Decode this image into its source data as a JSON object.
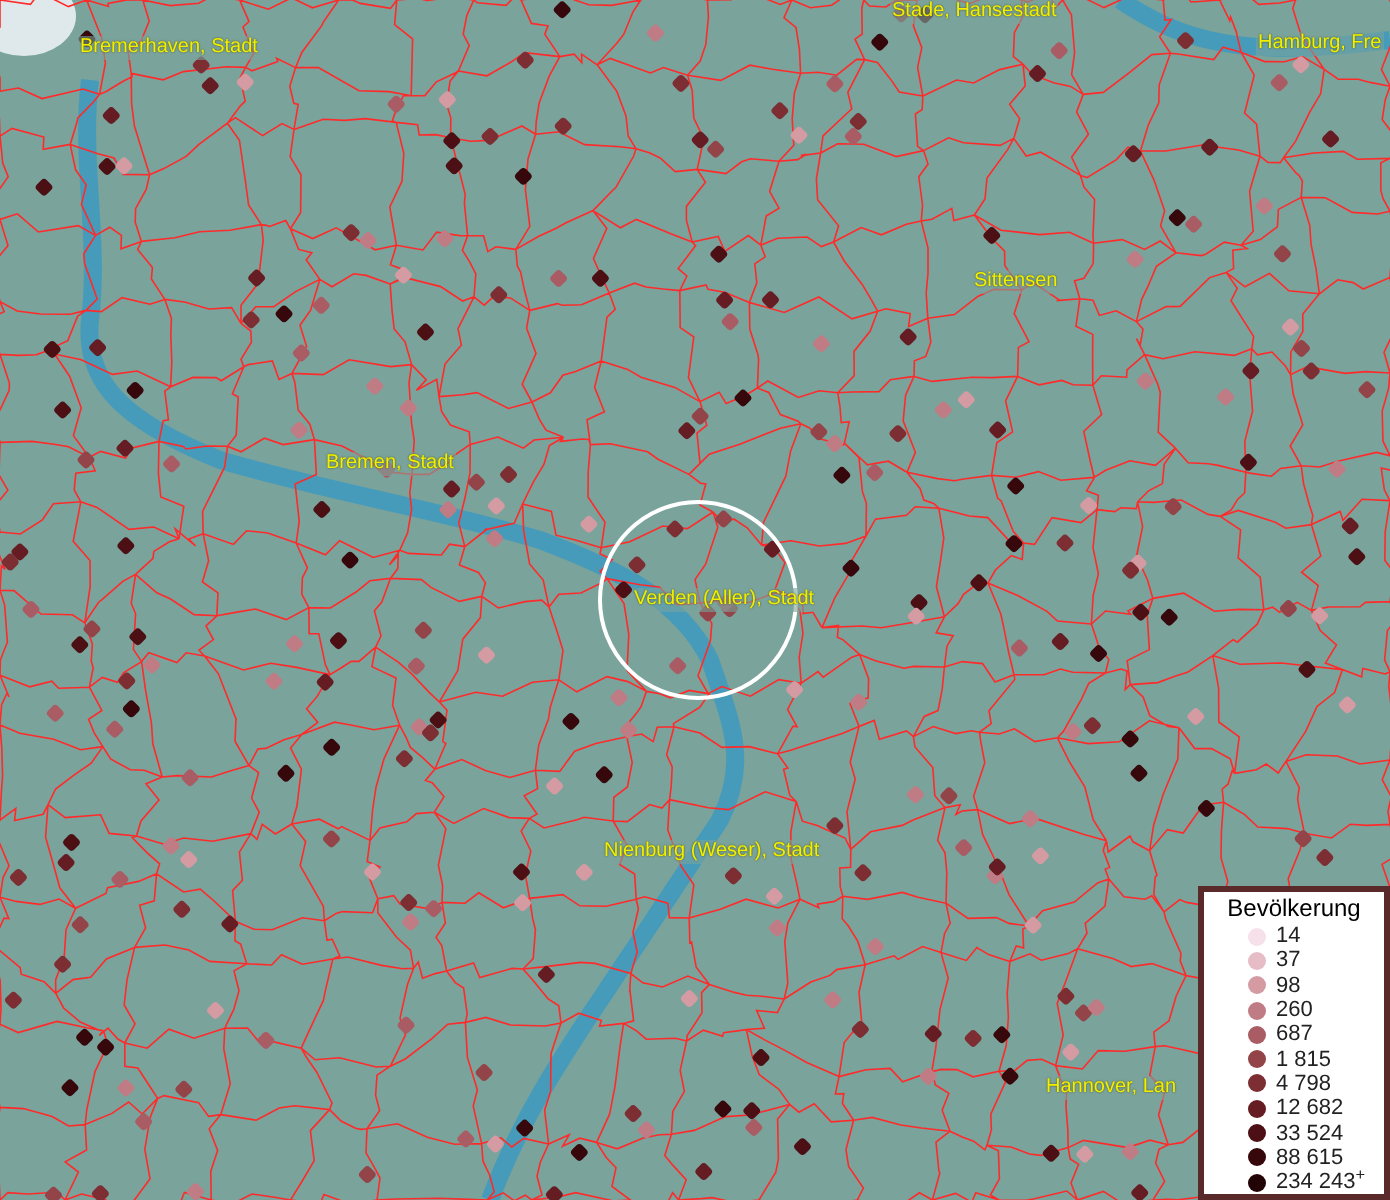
{
  "map_labels": [
    {
      "text": "Stade, Hansestadt"
    },
    {
      "text": "Bremerhaven, Stadt"
    },
    {
      "text": "Hamburg, Fre"
    },
    {
      "text": "Sittensen"
    },
    {
      "text": "Bremen, Stadt"
    },
    {
      "text": "Verden (Aller), Stadt"
    },
    {
      "text": "Nienburg (Weser), Stadt"
    },
    {
      "text": "Hannover, Lan"
    }
  ],
  "legend": {
    "title": "Bevölkerung",
    "items": [
      {
        "label": "14",
        "color": "#f6e0ea"
      },
      {
        "label": "37",
        "color": "#e6bcc6"
      },
      {
        "label": "98",
        "color": "#d49ba3"
      },
      {
        "label": "260",
        "color": "#c07c84"
      },
      {
        "label": "687",
        "color": "#a95c63"
      },
      {
        "label": "1 815",
        "color": "#924448"
      },
      {
        "label": "4 798",
        "color": "#7c2e33"
      },
      {
        "label": "12 682",
        "color": "#651c22"
      },
      {
        "label": "33 524",
        "color": "#4b0f14"
      },
      {
        "label": "88 615",
        "color": "#36070b"
      },
      {
        "label": "234 243$^{+}$",
        "color": "#220407"
      }
    ]
  }
}
